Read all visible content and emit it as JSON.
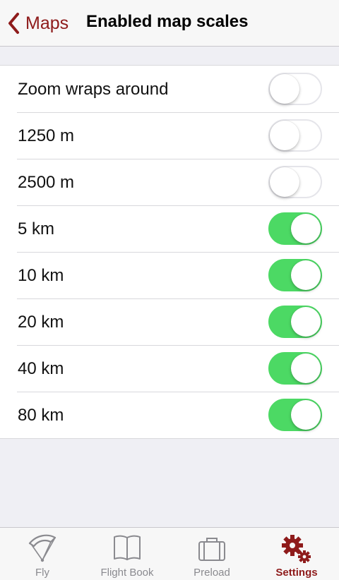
{
  "navbar": {
    "back_label": "Maps",
    "title": "Enabled map scales"
  },
  "settings": [
    {
      "label": "Zoom wraps around",
      "enabled": false
    },
    {
      "label": "1250 m",
      "enabled": false
    },
    {
      "label": "2500 m",
      "enabled": false
    },
    {
      "label": "5 km",
      "enabled": true
    },
    {
      "label": "10 km",
      "enabled": true
    },
    {
      "label": "20 km",
      "enabled": true
    },
    {
      "label": "40 km",
      "enabled": true
    },
    {
      "label": "80 km",
      "enabled": true
    }
  ],
  "tabs": [
    {
      "label": "Fly",
      "icon": "paraglider-icon",
      "active": false
    },
    {
      "label": "Flight Book",
      "icon": "book-icon",
      "active": false
    },
    {
      "label": "Preload",
      "icon": "suitcase-icon",
      "active": false
    },
    {
      "label": "Settings",
      "icon": "gears-icon",
      "active": true
    }
  ],
  "colors": {
    "accent": "#8e1b1b",
    "toggle_on": "#4cd964",
    "tab_inactive": "#8a8a8f"
  }
}
